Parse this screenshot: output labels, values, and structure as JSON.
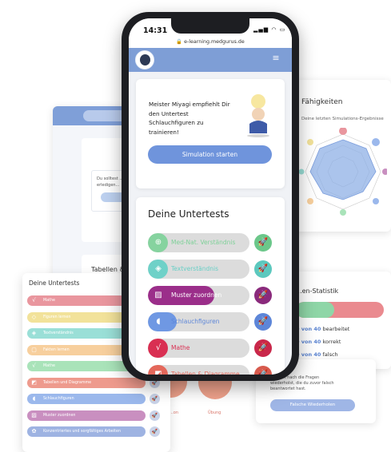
{
  "phone": {
    "time": "14:31",
    "signal": "▂▄▆ ◠ ▭",
    "url": "🔒 e-learning.medgurus.de",
    "recommendation": "Meister Miyagi empfiehlt Dir den Untertest Schlauchfiguren zu trainieren!",
    "sim_button": "Simulation starten",
    "tests_heading": "Deine Untertests",
    "tests": [
      {
        "label": "Med-Nat. Verständnis",
        "icon": "⊕",
        "fill": 0.2,
        "color": "#86d39f",
        "icon_color": "#6bc78a",
        "text_color": "#7fd199"
      },
      {
        "label": "Textverständnis",
        "icon": "◈",
        "fill": 0.2,
        "color": "#6fd1c8",
        "icon_color": "#5cc8be",
        "text_color": "#69cfc6"
      },
      {
        "label": "Muster zuordnen",
        "icon": "▨",
        "fill": 0.65,
        "color": "#9b2e8a",
        "icon_color": "#8a2a7c",
        "text_color": "#ffffff"
      },
      {
        "label": "Schlauchfiguren",
        "icon": "◖",
        "fill": 0.28,
        "color": "#6f98e3",
        "icon_color": "#5d86d8",
        "text_color": "#5d86d8"
      },
      {
        "label": "Mathe",
        "icon": "√",
        "fill": 0.2,
        "color": "#d92f52",
        "icon_color": "#c9274a",
        "text_color": "#d92f52"
      },
      {
        "label": "Tabellen & Diagramme",
        "icon": "◩",
        "fill": 0.2,
        "color": "#e4685b",
        "icon_color": "#d75a4d",
        "text_color": "#e4685b"
      }
    ]
  },
  "back_left": {
    "inner_text": "Du solltest ... erledigen..."
  },
  "back_left_card2": {
    "title": "Tabellen &"
  },
  "back_right_top": {
    "title": "Fähigkeiten",
    "subtitle": "Deine letzten Simulations-Ergebnisse",
    "note": "letzten Übung hast du ... erreicht (0%). ... du besser als 10% ..."
  },
  "back_right_mid": {
    "title": "...en-Statistik",
    "stat1_num": "0 von 40",
    "stat1_txt": " bearbeitet",
    "stat2_num": "0 von 40",
    "stat2_txt": " korrekt",
    "stat3_num": "0 von 40",
    "stat3_txt": " falsch"
  },
  "back_right_bottom": {
    "text": "...nstart nach die Fragen wiederholst, die du zuvor falsch beantwortet hast.",
    "button": "Falsche Wiederholen"
  },
  "back_center_bottom": {
    "label1": "...on",
    "label2": "Übung"
  },
  "front_left": {
    "title": "Deine Untertests",
    "items": [
      {
        "label": "Mathe",
        "color": "#e9969e",
        "icon": "√"
      },
      {
        "label": "Figuren lernen",
        "color": "#f2e29a",
        "icon": "◇"
      },
      {
        "label": "Textverständnis",
        "color": "#9adfd7",
        "icon": "◈"
      },
      {
        "label": "Fakten lernen",
        "color": "#f7cf9d",
        "icon": "▢"
      },
      {
        "label": "Mathe",
        "color": "#a9e3b9",
        "icon": "√"
      },
      {
        "label": "Tabellen und Diagramme",
        "color": "#ee9a8d",
        "icon": "◩"
      },
      {
        "label": "Schlauchfiguren",
        "color": "#9bb8ec",
        "icon": "◖"
      },
      {
        "label": "Muster zuordnen",
        "color": "#c98fc0",
        "icon": "▨"
      },
      {
        "label": "Konzentriertes und sorgfältiges Arbeiten",
        "color": "#9eb3e2",
        "icon": "✿"
      }
    ],
    "go_color": "#c9d3e8"
  },
  "colors": {
    "primary": "#7e9ed6",
    "accent_blue": "#6f94dc"
  }
}
